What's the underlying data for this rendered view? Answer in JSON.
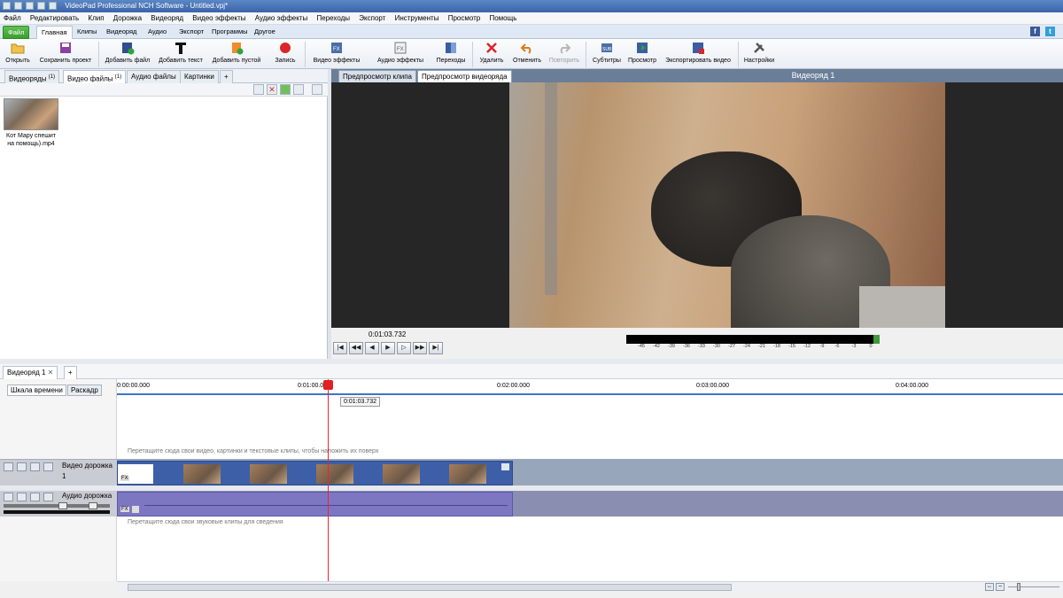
{
  "window": {
    "title": "VideoPad Professional NCH Software - Untitled.vpj*"
  },
  "menu": [
    "Файл",
    "Редактировать",
    "Клип",
    "Дорожка",
    "Видеоряд",
    "Видео эффекты",
    "Аудио эффекты",
    "Переходы",
    "Экспорт",
    "Инструменты",
    "Просмотр",
    "Помощь"
  ],
  "ribbon_tabs": [
    "Файл",
    "Главная",
    "Клипы",
    "Видеоряд",
    "Аудио",
    "Экспорт",
    "Программы",
    "Другое"
  ],
  "social": {
    "facebook": "f",
    "twitter": "t"
  },
  "toolbar": {
    "open": "Открыть",
    "save_project": "Сохранить проект",
    "add_file": "Добавить файл",
    "add_text": "Добавить текст",
    "add_blank": "Добавить пустой",
    "record": "Запись",
    "video_effects": "Видео эффекты",
    "audio_effects": "Аудио эффекты",
    "transitions": "Переходы",
    "delete": "Удалить",
    "undo": "Отменить",
    "redo": "Повторить",
    "subtitles": "Субтитры",
    "preview": "Просмотр",
    "export_video": "Экспортировать видео",
    "settings": "Настройки"
  },
  "bin_tabs": [
    {
      "label": "Видеоряды",
      "count": "(1)"
    },
    {
      "label": "Видео файлы",
      "count": "(1)"
    },
    {
      "label": "Аудио файлы",
      "count": ""
    },
    {
      "label": "Картинки",
      "count": ""
    },
    {
      "label": "+",
      "count": ""
    }
  ],
  "media": {
    "file_name_line1": "Кот Мару спешит",
    "file_name_line2": "на помощь).mp4"
  },
  "preview": {
    "tab_clip": "Предпросмотр клипа",
    "tab_sequence": "Предпросмотр видеоряда",
    "sequence_title": "Видеоряд 1",
    "time": "0:01:03.732"
  },
  "meter_ticks": [
    "-45",
    "-42",
    "-39",
    "-36",
    "-33",
    "-30",
    "-27",
    "-24",
    "-21",
    "-18",
    "-15",
    "-12",
    "-9",
    "-6",
    "-3",
    "0"
  ],
  "timeline": {
    "seq_tab": "Видеоряд 1",
    "add_tab": "+",
    "view_timeline": "Шкала времени",
    "view_storyboard": "Раскадр",
    "ruler": [
      "0:00:00.000",
      "0:01:00.000",
      "0:02:00.000",
      "0:03:00.000",
      "0:04:00.000"
    ],
    "playhead_time": "0:01:03.732",
    "overlay_hint": "Перетащите сюда свои видео, картинки и текстовые клипы, чтобы наложить их поверх",
    "video_track": "Видео дорожка 1",
    "audio_track": "Аудио дорожка 1",
    "audio_hint": "Перетащите сюда свои звуковые клипы для сведения",
    "fx_label": "FX"
  },
  "colors": {
    "file_tab": "#3a9e30",
    "playhead": "#e02020",
    "video_clip": "#3d5fa8",
    "audio_clip": "#7d77c2"
  }
}
